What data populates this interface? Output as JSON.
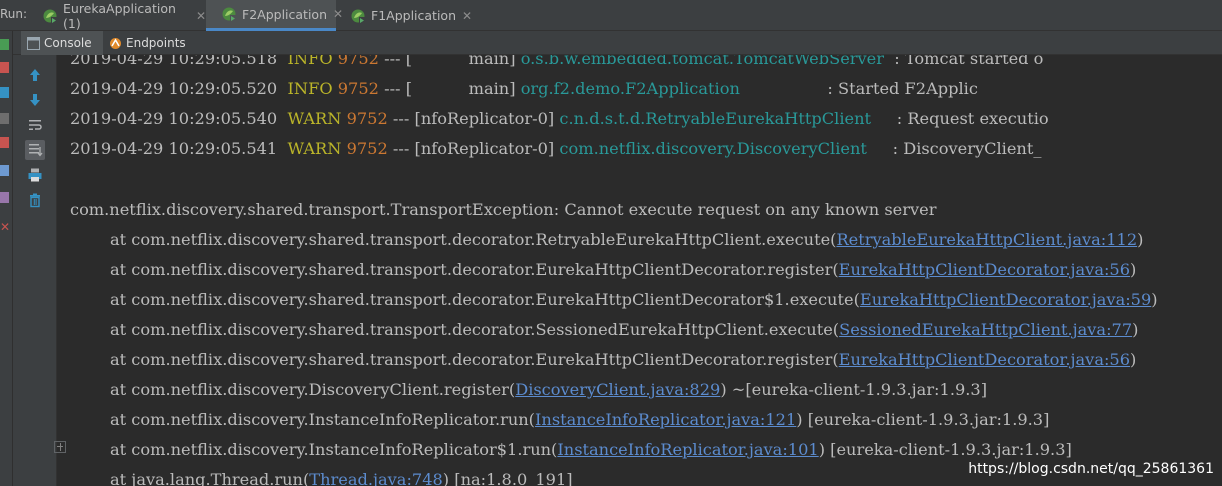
{
  "run_bar": {
    "label": "Run:",
    "tabs": [
      {
        "label": "EurekaApplication (1)",
        "active": false
      },
      {
        "label": "F2Application",
        "active": true
      },
      {
        "label": "F1Application",
        "active": false
      }
    ],
    "close_glyph": "✕"
  },
  "toolbar": {
    "console_label": "Console",
    "endpoints_label": "Endpoints"
  },
  "colors": {
    "background": "#2b2b2b",
    "panel": "#3c3f41",
    "accent": "#4a88c7",
    "log_level": "#bbb529",
    "pid": "#cc7832",
    "logger": "#299999",
    "link": "#5c8ccf"
  },
  "console": {
    "log_lines": [
      {
        "date": "2019-04-29 10:29:05.518",
        "level": "INFO",
        "pid": "9752",
        "sep": "---",
        "thread": "[           main]",
        "logger": "o.s.b.w.embedded.tomcat.TomcatWebServer",
        "message": ": Tomcat started o"
      },
      {
        "date": "2019-04-29 10:29:05.520",
        "level": "INFO",
        "pid": "9752",
        "sep": "---",
        "thread": "[           main]",
        "logger": "org.f2.demo.F2Application               ",
        "message": ": Started F2Applic"
      },
      {
        "date": "2019-04-29 10:29:05.540",
        "level": "WARN",
        "pid": "9752",
        "sep": "---",
        "thread": "[nfoReplicator-0]",
        "logger": "c.n.d.s.t.d.RetryableEurekaHttpClient   ",
        "message": ": Request executio"
      },
      {
        "date": "2019-04-29 10:29:05.541",
        "level": "WARN",
        "pid": "9752",
        "sep": "---",
        "thread": "[nfoReplicator-0]",
        "logger": "com.netflix.discovery.DiscoveryClient   ",
        "message": ": DiscoveryClient_"
      }
    ],
    "exception": "com.netflix.discovery.shared.transport.TransportException: Cannot execute request on any known server",
    "trace": [
      {
        "prefix": "at com.netflix.discovery.shared.transport.decorator.RetryableEurekaHttpClient.execute(",
        "link": "RetryableEurekaHttpClient.java:112",
        "suffix": ")"
      },
      {
        "prefix": "at com.netflix.discovery.shared.transport.decorator.EurekaHttpClientDecorator.register(",
        "link": "EurekaHttpClientDecorator.java:56",
        "suffix": ")"
      },
      {
        "prefix": "at com.netflix.discovery.shared.transport.decorator.EurekaHttpClientDecorator$1.execute(",
        "link": "EurekaHttpClientDecorator.java:59",
        "suffix": ")"
      },
      {
        "prefix": "at com.netflix.discovery.shared.transport.decorator.SessionedEurekaHttpClient.execute(",
        "link": "SessionedEurekaHttpClient.java:77",
        "suffix": ")"
      },
      {
        "prefix": "at com.netflix.discovery.shared.transport.decorator.EurekaHttpClientDecorator.register(",
        "link": "EurekaHttpClientDecorator.java:56",
        "suffix": ")"
      },
      {
        "prefix": "at com.netflix.discovery.DiscoveryClient.register(",
        "link": "DiscoveryClient.java:829",
        "suffix": ") ~[eureka-client-1.9.3.jar:1.9.3]"
      },
      {
        "prefix": "at com.netflix.discovery.InstanceInfoReplicator.run(",
        "link": "InstanceInfoReplicator.java:121",
        "suffix": ") [eureka-client-1.9.3.jar:1.9.3]"
      },
      {
        "prefix": "at com.netflix.discovery.InstanceInfoReplicator$1.run(",
        "link": "InstanceInfoReplicator.java:101",
        "suffix": ") [eureka-client-1.9.3.jar:1.9.3]"
      },
      {
        "prefix": "at java.lang.Thread.run(",
        "link": "Thread.java:748",
        "suffix": ") [na:1.8.0_191]"
      }
    ]
  },
  "action_icons": [
    "arrow-up-icon",
    "arrow-down-icon",
    "soft-wrap-icon",
    "scroll-to-end-icon",
    "print-icon",
    "trash-icon"
  ],
  "watermark": "https://blog.csdn.net/qq_25861361"
}
